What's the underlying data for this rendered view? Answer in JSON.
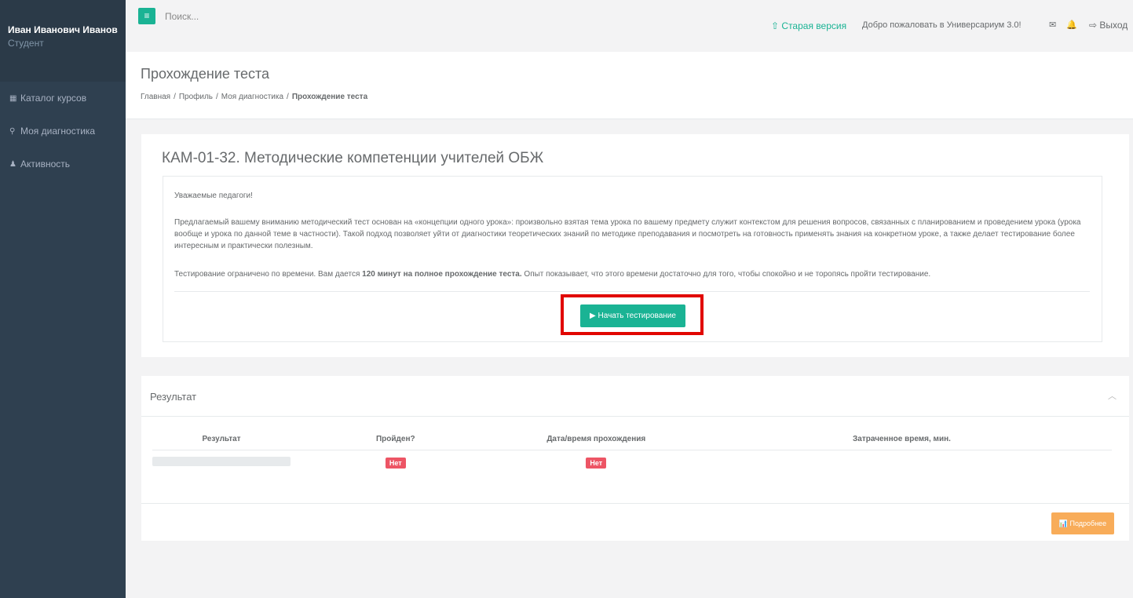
{
  "sidebar": {
    "user_name": "Иван Иванович Иванов",
    "user_role": "Студент",
    "items": [
      {
        "icon": "grid-icon",
        "glyph": "▦",
        "label": "Каталог курсов"
      },
      {
        "icon": "diagnostics-icon",
        "glyph": "⚲",
        "label": "Моя диагностика"
      },
      {
        "icon": "user-icon",
        "glyph": "♟",
        "label": "Активность"
      }
    ]
  },
  "topbar": {
    "menu_glyph": "≡",
    "search_placeholder": "Поиск...",
    "old_version": "Старая версия",
    "old_version_glyph": "⇧",
    "welcome": "Добро пожаловать в Универсариум 3.0!",
    "envelope_glyph": "✉",
    "bell_glyph": "🔔",
    "logout_glyph": "⇨",
    "logout": "Выход"
  },
  "heading": {
    "title": "Прохождение теста",
    "breadcrumb": [
      "Главная",
      "Профиль",
      "Моя диагностика",
      "Прохождение теста"
    ]
  },
  "test": {
    "title": "КАМ-01-32. Методические компетенции учителей ОБЖ",
    "greeting": "Уважаемые педагоги!",
    "paragraph1": "Предлагаемый вашему вниманию методический тест основан на «концепции одного урока»: произвольно взятая тема урока по вашему предмету служит контекстом для решения вопросов, связанных с планированием и проведением урока (урока вообще и урока по данной теме в частности). Такой подход позволяет уйти от диагностики теоретических знаний по методике преподавания и посмотреть на готовность применять знания на конкретном уроке, а также делает тестирование более интересным и практически полезным.",
    "paragraph2_start": "Тестирование ограничено по времени. Вам дается ",
    "paragraph2_bold": "120 минут на полное прохождение теста.",
    "paragraph2_end": " Опыт показывает, что этого времени достаточно для того, чтобы спокойно и не торопясь пройти тестирование.",
    "start_button": "▶ Начать тестирование"
  },
  "result": {
    "title": "Результат",
    "collapse_glyph": "︿",
    "columns": [
      "Результат",
      "Пройден?",
      "Дата/время прохождения",
      "Затраченное время, мин."
    ],
    "row": {
      "passed": "Нет",
      "date": "Нет"
    },
    "more_button": "📊 Подробнее"
  },
  "colors": {
    "sidebar": "#2f4050",
    "accent": "#1ab394",
    "danger": "#ed5565",
    "warning": "#f8ac59",
    "highlight": "#e10600"
  }
}
